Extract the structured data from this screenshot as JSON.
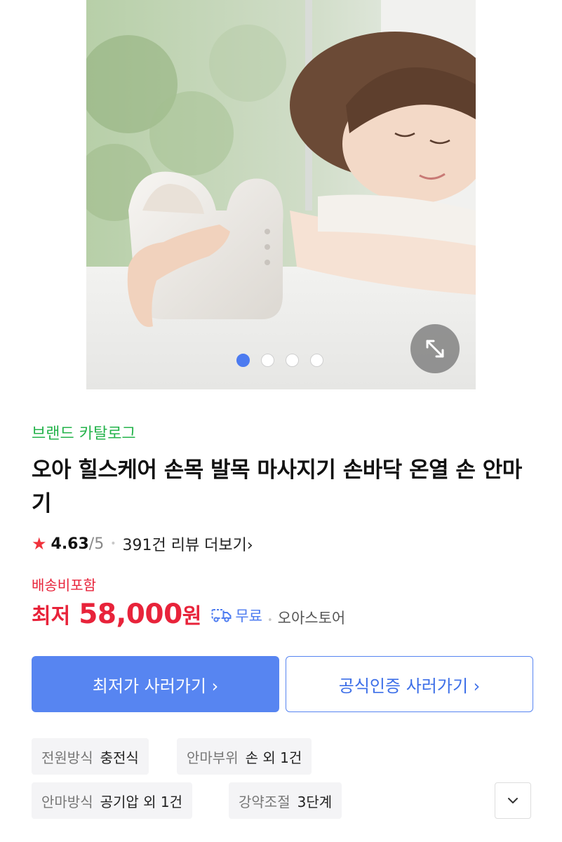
{
  "product": {
    "brand_link": "브랜드 카탈로그",
    "title": "오아 힐스케어 손목 발목 마사지기 손바닥 온열 손 안마기",
    "image_alt": "product-photo",
    "carousel": {
      "count": 4,
      "active_index": 0
    }
  },
  "rating": {
    "star": "★",
    "value": "4.63",
    "max": "/5",
    "separator": "•",
    "review_link": "391건 리뷰 더보기",
    "review_chevron": "›"
  },
  "price": {
    "shipping_included": "배송비포함",
    "prefix": "최저",
    "amount": "58,000",
    "unit": "원",
    "shipping_label": "무료",
    "separator": "•",
    "store": "오아스토어"
  },
  "buttons": {
    "lowest": "최저가 사러가기 ›",
    "official": "공식인증 사러가기 ›"
  },
  "specs": [
    {
      "label": "전원방식",
      "value": "충전식"
    },
    {
      "label": "안마부위",
      "value": "손 외 1건"
    },
    {
      "label": "안마방식",
      "value": "공기압 외 1건"
    },
    {
      "label": "강약조절",
      "value": "3단계"
    }
  ],
  "colors": {
    "accent_blue": "#5785f1",
    "price_red": "#e8233a",
    "brand_green": "#24b34b"
  },
  "icons": {
    "expand": "expand-diagonal-icon",
    "truck": "truck-icon",
    "chevron_down": "chevron-down-icon",
    "star": "star-icon"
  }
}
